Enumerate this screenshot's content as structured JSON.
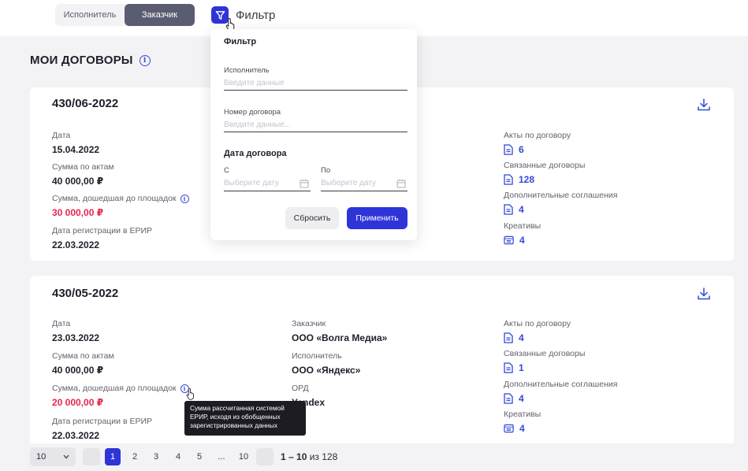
{
  "tabs": {
    "executor": "Исполнитель",
    "customer": "Заказчик"
  },
  "filter": {
    "label": "Фильтр"
  },
  "page": {
    "title": "МОИ ДОГОВОРЫ"
  },
  "popover": {
    "title": "Фильтр",
    "executor_label": "Исполнитель",
    "executor_placeholder": "Введите данные",
    "contract_label": "Номер договора",
    "contract_placeholder": "Введите данные...",
    "date_section": "Дата договора",
    "from_label": "С",
    "to_label": "По",
    "from_placeholder": "Выберите дату",
    "to_placeholder": "Выберите дату",
    "reset": "Сбросить",
    "apply": "Применить"
  },
  "contracts": [
    {
      "number": "430/06-2022",
      "date_label": "Дата",
      "date": "15.04.2022",
      "acts_sum_label": "Сумма по актам",
      "acts_sum": "40 000,00 ₽",
      "platform_sum_label": "Сумма, дошедшая до площадок",
      "platform_sum": "30 000,00 ₽",
      "erir_label": "Дата регистрации в ЕРИР",
      "erir_date": "22.03.2022",
      "acts_label": "Акты по договору",
      "acts": "6",
      "related_label": "Связанные договоры",
      "related": "128",
      "extra_label": "Дополнительные соглашения",
      "extra": "4",
      "creatives_label": "Креативы",
      "creatives": "4"
    },
    {
      "number": "430/05-2022",
      "date_label": "Дата",
      "date": "23.03.2022",
      "acts_sum_label": "Сумма по актам",
      "acts_sum": "40 000,00 ₽",
      "platform_sum_label": "Сумма, дошедшая до площадок",
      "platform_sum": "20 000,00 ₽",
      "erir_label": "Дата регистрации в ЕРИР",
      "erir_date": "22.03.2022",
      "customer_label": "Заказчик",
      "customer": "ООО «Волга Медиа»",
      "executor_label": "Исполнитель",
      "executor": "ООО «Яндекс»",
      "ord_label": "ОРД",
      "ord": "Yandex",
      "acts_label": "Акты по договору",
      "acts": "4",
      "related_label": "Связанные договоры",
      "related": "1",
      "extra_label": "Дополнительные соглашения",
      "extra": "4",
      "creatives_label": "Креативы",
      "creatives": "4"
    }
  ],
  "tooltip": {
    "line1": "Сумма рассчитанная системой",
    "line2": "ЕРИР, исходя из обобщенных",
    "line3": "зарегистрированных данных"
  },
  "pagination": {
    "per_page": "10",
    "pages": [
      "1",
      "2",
      "3",
      "4",
      "5",
      "...",
      "10"
    ],
    "current": "1",
    "range": "1 – 10",
    "of": "из 128"
  },
  "colors": {
    "accent": "#2f34d8",
    "red": "#e6264f",
    "tab_active": "#5a5d72"
  }
}
